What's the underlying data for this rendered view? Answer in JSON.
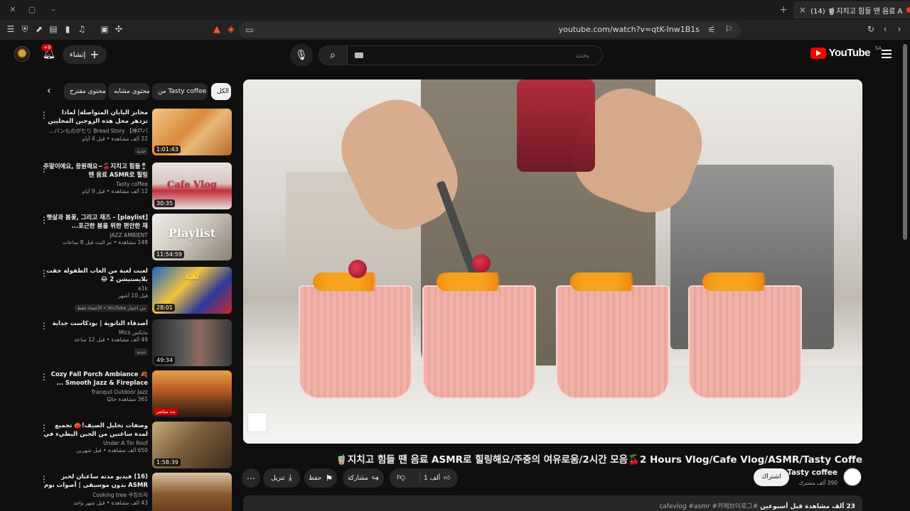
{
  "browser": {
    "tab_title": "(14) 🧋지치고 힘들 땐 음료 A",
    "new_tab_symbol": "+",
    "close_tab_symbol": "×",
    "url": "youtube.com/watch?v=qtK-Inw1B1s"
  },
  "masthead": {
    "logo_text": "YouTube",
    "country_code": "SA",
    "search_placeholder": "بحث",
    "create_label": "إنشاء",
    "notification_count": "+9"
  },
  "chips": [
    {
      "label": "الكل",
      "active": true
    },
    {
      "label": "من Tasty coffee",
      "active": false
    },
    {
      "label": "محتوى مشابه",
      "active": false
    },
    {
      "label": "محتوى مقترح",
      "active": false
    }
  ],
  "recommendations": [
    {
      "title": "مخابز اليابان المتواصلة| لماذا تزدهر محل هذه الزوجين المحليين من الساعة 2 صباحًا لمدة ...",
      "channel": "パンものがたり Bread Story 【神戸パ...",
      "stats": "22 ألف مشاهدة • قبل 4 أيام",
      "badge": "جديد",
      "duration": "1:01:43",
      "thumb_text": ""
    },
    {
      "title": "🍷주말이에요, 응원해요~🍒지치고 힘들 땐 음료 ASMR로 힐링",
      "channel": "Tasty coffee",
      "stats": "12 ألف مشاهدة • قبل 9 أيام",
      "badge": "",
      "duration": "30:35",
      "thumb_text": "Cafe Vlog"
    },
    {
      "title": "[playlist] 햇살과 봄꽃, 그리고 재즈 - 포근한 봄을 위한 편안한 재...",
      "channel": "JAZZ AMBIENT",
      "stats": "148 مشاهدة • تم البث قبل 8 ساعات",
      "badge": "",
      "duration": "11:54:59",
      "thumb_text": "Playlist"
    },
    {
      "title": "لعبت لعبة من العاب الطفولة حقت بلايستيشن 2 😂",
      "channel": "e1k",
      "stats": "قبل 10 أشهر",
      "badge": "من اختيار YouTube • الأعضاء فقط",
      "duration": "28:01",
      "thumb_text": "لعبة"
    },
    {
      "title": "أصدقاء الثانوية | بودكاست جداية",
      "channel": "مايكس Mics",
      "stats": "49 ألف مشاهدة • قبل 12 ساعة",
      "badge": "جديد",
      "duration": "49:34",
      "thumb_text": ""
    },
    {
      "title": "Cozy Fall Porch Ambiance 🍂 Smooth Jazz & Fireplace ...",
      "channel": "Tranquil Outdoor Jazz",
      "stats": "361 مشاهدة حاليًا",
      "badge": "بث مباشر",
      "duration": "",
      "thumb_text": ""
    },
    {
      "title": "وصفات تخليل الصيف!🍅 تجميع لمدة ساعتين من الجبن البطيء في الريف 🍅",
      "channel": "Under A Tin Roof",
      "stats": "650 ألف مشاهدة • قبل شهرين",
      "badge": "",
      "duration": "1:58:39",
      "thumb_text": ""
    },
    {
      "title": "(16) فيديو مدته ساعتان لخبز ASMR بدون موسيقى | أصوات نوم مريحة | كعكة، كعكة ...",
      "channel": "Cooking tree 쿠킹트리",
      "stats": "43 ألف مشاهدة • قبل شهر واحد",
      "badge": "",
      "duration": "",
      "thumb_text": ""
    }
  ],
  "video": {
    "title": "🧋지치고 힘들 땐 음료 ASMR로 힐링해요/주중의 여유로움/2시간 모음🍒2 Hours Vlog/Cafe Vlog/ASMR/Tasty Coffe",
    "channel": "Tasty coffee",
    "subscribers": "390 ألف مشترك",
    "subscribe_label": "اشتراك",
    "like_count": "1 ألف",
    "share_label": "مشاركة",
    "save_label": "حفظ",
    "download_label": "تنزيل",
    "description_stats": "23 ألف مشاهدة قبل أسبوعين",
    "description_tags": "#cafevlog #asmr #카페브이로그"
  },
  "colors": {
    "accent": "#ff0000",
    "background": "#0f0f0f",
    "chip": "#272727"
  }
}
